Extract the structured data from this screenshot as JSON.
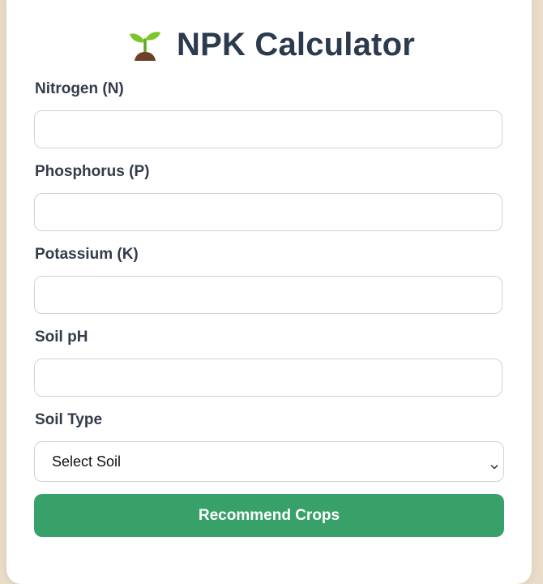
{
  "header": {
    "title": "NPK Calculator",
    "icon": "seedling-icon"
  },
  "form": {
    "fields": [
      {
        "label": "Nitrogen (N)",
        "value": "",
        "placeholder": ""
      },
      {
        "label": "Phosphorus (P)",
        "value": "",
        "placeholder": ""
      },
      {
        "label": "Potassium (K)",
        "value": "",
        "placeholder": ""
      },
      {
        "label": "Soil pH",
        "value": "",
        "placeholder": ""
      }
    ],
    "soil_type": {
      "label": "Soil Type",
      "selected": "Select Soil"
    },
    "submit_label": "Recommend Crops"
  },
  "colors": {
    "background": "#e9dcc8",
    "title": "#2c3a4e",
    "button": "#38a169",
    "sprout_green": "#7bc628",
    "soil_brown": "#6d4128"
  }
}
